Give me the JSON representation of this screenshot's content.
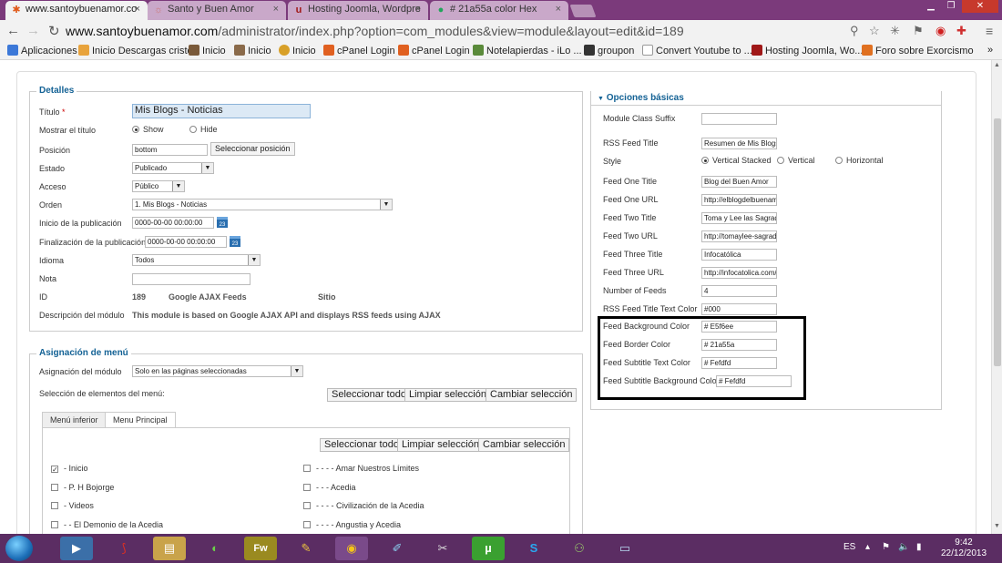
{
  "browser": {
    "tabs": [
      {
        "title": "www.santoybuenamor.co",
        "active": true,
        "icon": "joomla-icon"
      },
      {
        "title": "Santo y Buen Amor",
        "active": false,
        "icon": "sun-icon"
      },
      {
        "title": "Hosting Joomla, Wordpre",
        "active": false,
        "icon": "hosting-icon"
      },
      {
        "title": "# 21a55a color Hex",
        "active": false,
        "icon": "color-icon"
      }
    ],
    "tab_close": "×",
    "url_host": "www.santoybuenamor.com",
    "url_path": "/administrator/index.php?option=com_modules&view=module&layout=edit&id=189",
    "bookmarks": [
      {
        "label": "Aplicaciones",
        "color": "#3c78d8"
      },
      {
        "label": "Inicio Descargas cristo",
        "color": "#e8a33c"
      },
      {
        "label": "Inicio",
        "color": "#7a5a3a"
      },
      {
        "label": "Inicio",
        "color": "#8a6a4a"
      },
      {
        "label": "Inicio",
        "color": "#d8a028"
      },
      {
        "label": "cPanel Login",
        "color": "#e06020"
      },
      {
        "label": "cPanel Login",
        "color": "#e06020"
      },
      {
        "label": "Notelapierdas - iLo ...",
        "color": "#5a8a3a"
      },
      {
        "label": "groupon",
        "color": "#333333"
      },
      {
        "label": "Convert Youtube to ...",
        "color": "#dddddd"
      },
      {
        "label": "Hosting Joomla, Wo...",
        "color": "#a01818"
      },
      {
        "label": "Foro sobre Exorcismo",
        "color": "#e07020"
      }
    ],
    "more_bookmarks": "»"
  },
  "detalles": {
    "legend": "Detalles",
    "titulo_label": "Título",
    "required_mark": "*",
    "titulo_value": "Mis Blogs - Noticias",
    "mostrar_titulo_label": "Mostrar el título",
    "show_label": "Show",
    "hide_label": "Hide",
    "posicion_label": "Posición",
    "posicion_value": "bottom",
    "seleccionar_posicion": "Seleccionar posición",
    "estado_label": "Estado",
    "estado_value": "Publicado",
    "acceso_label": "Acceso",
    "acceso_value": "Público",
    "orden_label": "Orden",
    "orden_value": "1. Mis Blogs - Noticias",
    "inicio_pub_label": "Inicio de la publicación",
    "inicio_pub_value": "0000-00-00 00:00:00",
    "fin_pub_label": "Finalización de la publicación",
    "fin_pub_value": "0000-00-00 00:00:00",
    "calendar_glyph": "23",
    "idioma_label": "Idioma",
    "idioma_value": "Todos",
    "nota_label": "Nota",
    "nota_value": "",
    "id_label": "ID",
    "id_value": "189",
    "module_type": "Google AJAX Feeds",
    "client": "Sitio",
    "descripcion_label": "Descripción del módulo",
    "descripcion_value": "This module is based on Google AJAX API and displays RSS feeds using AJAX"
  },
  "asignacion": {
    "legend": "Asignación de menú",
    "modulo_label": "Asignación del módulo",
    "modulo_value": "Solo en las páginas seleccionadas",
    "seleccion_label": "Selección de elementos del menú:",
    "btn_seleccionar_todo": "Seleccionar todo",
    "btn_limpiar": "Limpiar selección",
    "btn_cambiar": "Cambiar selección",
    "tab_menu_inferior": "Menú inferior",
    "tab_menu_principal": "Menu Principal",
    "items_left": [
      {
        "label": "- Inicio",
        "checked": true
      },
      {
        "label": "- P. H Bojorge",
        "checked": false
      },
      {
        "label": "- Videos",
        "checked": false
      },
      {
        "label": "- - El Demonio de la Acedia",
        "checked": false
      }
    ],
    "items_right": [
      {
        "label": "- - - - Amar Nuestros Límites",
        "checked": false
      },
      {
        "label": "- - - Acedia",
        "checked": false
      },
      {
        "label": "- - - - Civilización de la Acedia",
        "checked": false
      },
      {
        "label": "- - - - Angustia y Acedia",
        "checked": false
      }
    ]
  },
  "opciones": {
    "legend": "Opciones básicas",
    "legend_marker": "▼",
    "fields": [
      {
        "label": "Module Class Suffix",
        "value": ""
      },
      {
        "label": "RSS Feed Title",
        "value": "Resumen de Mis Blogs"
      },
      {
        "label": "Feed One Title",
        "value": "Blog del Buen Amor"
      },
      {
        "label": "Feed One URL",
        "value": "http://elblogdelbuenamor"
      },
      {
        "label": "Feed Two Title",
        "value": "Toma y Lee las Sagradas"
      },
      {
        "label": "Feed Two URL",
        "value": "http://tomaylee-sagradas"
      },
      {
        "label": "Feed Three Title",
        "value": "Infocatólica"
      },
      {
        "label": "Feed Three URL",
        "value": "http://infocatolica.com/"
      },
      {
        "label": "Number of Feeds",
        "value": "4"
      },
      {
        "label": "RSS Feed Title Text Color",
        "value": "#000"
      },
      {
        "label": "Feed Background Color",
        "value": "# E5f6ee"
      },
      {
        "label": "Feed Border Color",
        "value": "# 21a55a"
      },
      {
        "label": "Feed Subtitle Text Color",
        "value": "# Fefdfd"
      },
      {
        "label": "Feed Subtitle Background Color",
        "value": "# Fefdfd"
      }
    ],
    "style_label": "Style",
    "style_options": [
      "Vertical Stacked",
      "Vertical",
      "Horizontal"
    ],
    "style_selected": "Vertical Stacked"
  },
  "taskbar": {
    "lang": "ES",
    "time": "9:42",
    "date": "22/12/2013",
    "apps": [
      "windows-explorer-icon",
      "media-player-icon",
      "acrobat-icon",
      "explorer-icon",
      "security-icon",
      "fireworks-icon",
      "paint-icon",
      "chrome-icon",
      "wordpad-icon",
      "sniper-icon",
      "utorrent-icon",
      "skype-icon",
      "network-icon",
      "notepad-icon"
    ]
  },
  "colors": {
    "tab_bar": "#7b3a7b",
    "legend_blue": "#146295",
    "taskbar": "#5b2d63",
    "title_input_bg": "#dce9f5"
  }
}
